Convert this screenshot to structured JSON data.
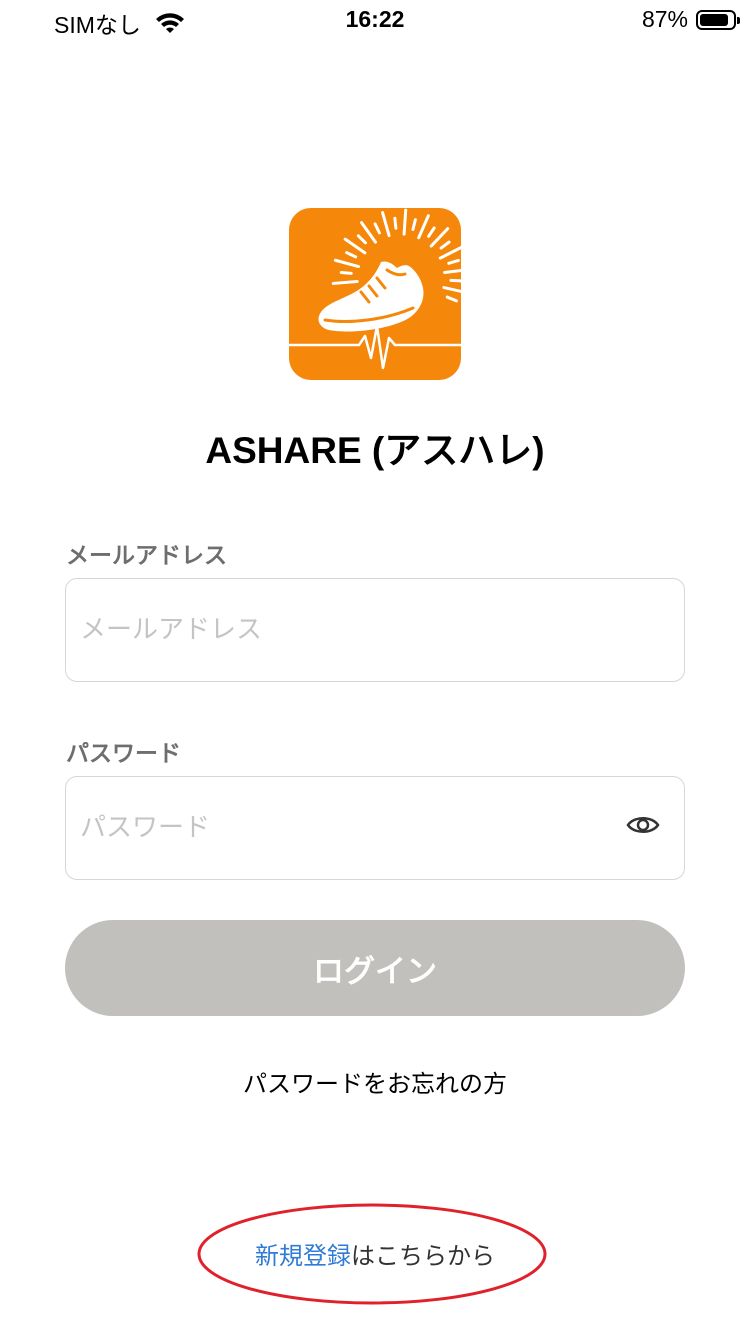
{
  "status_bar": {
    "carrier": "SIMなし",
    "time": "16:22",
    "battery_percent_text": "87%",
    "battery_level": 0.87
  },
  "app": {
    "title": "ASHARE (アスハレ)",
    "logo_color": "#f5870a"
  },
  "form": {
    "email": {
      "label": "メールアドレス",
      "placeholder": "メールアドレス",
      "value": ""
    },
    "password": {
      "label": "パスワード",
      "placeholder": "パスワード",
      "value": ""
    },
    "login_label": "ログイン",
    "forgot_password": "パスワードをお忘れの方",
    "register_link": "新規登録",
    "register_suffix": "はこちらから"
  },
  "colors": {
    "accent": "#2f7bd6",
    "button_disabled": "#c1c0bd",
    "annotation": "#e0202a"
  },
  "icons": [
    "wifi-icon",
    "battery-icon",
    "eye-icon"
  ]
}
